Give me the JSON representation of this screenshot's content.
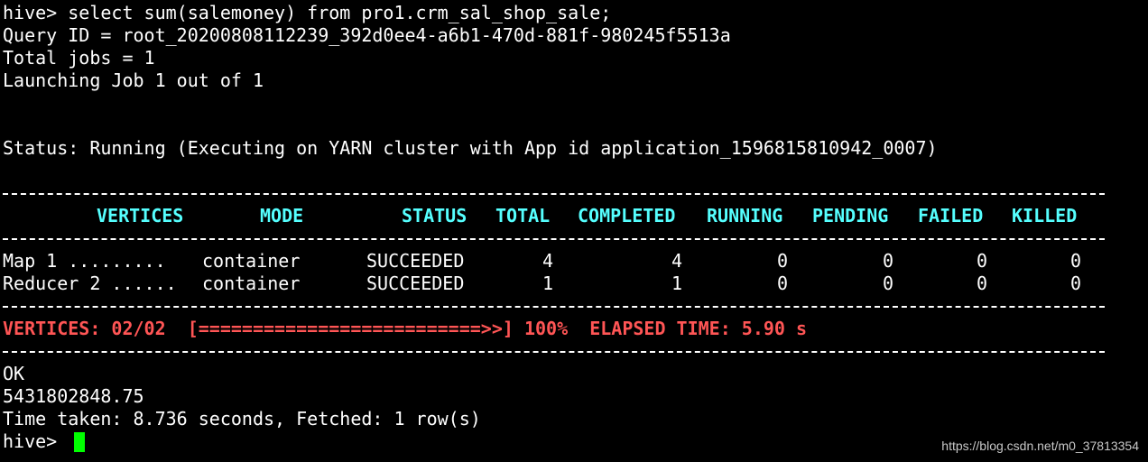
{
  "terminal": {
    "lines": {
      "command": "hive> select sum(salemoney) from pro1.crm_sal_shop_sale;",
      "query_id": "Query ID = root_20200808112239_392d0ee4-a6b1-470d-881f-980245f5513a",
      "total_jobs": "Total jobs = 1",
      "launching": "Launching Job 1 out of 1",
      "status": "Status: Running (Executing on YARN cluster with App id application_1596815810942_0007)"
    },
    "table": {
      "headers": [
        "VERTICES",
        "MODE",
        "STATUS",
        "TOTAL",
        "COMPLETED",
        "RUNNING",
        "PENDING",
        "FAILED",
        "KILLED"
      ],
      "rows": [
        [
          "Map 1 .........",
          "container",
          "SUCCEEDED",
          "4",
          "4",
          "0",
          "0",
          "0",
          "0"
        ],
        [
          "Reducer 2 ......",
          "container",
          "SUCCEEDED",
          "1",
          "1",
          "0",
          "0",
          "0",
          "0"
        ]
      ]
    },
    "summary": "VERTICES: 02/02  [==========================>>] 100%  ELAPSED TIME: 5.90 s",
    "result": {
      "ok": "OK",
      "value": "5431802848.75",
      "time_taken": "Time taken: 8.736 seconds, Fetched: 1 row(s)"
    },
    "prompt": "hive>"
  },
  "watermark": "https://blog.csdn.net/m0_37813354",
  "colors": {
    "background": "#000000",
    "text": "#ffffff",
    "header": "#55ffff",
    "summary": "#ff5555",
    "cursor": "#00ff00"
  }
}
